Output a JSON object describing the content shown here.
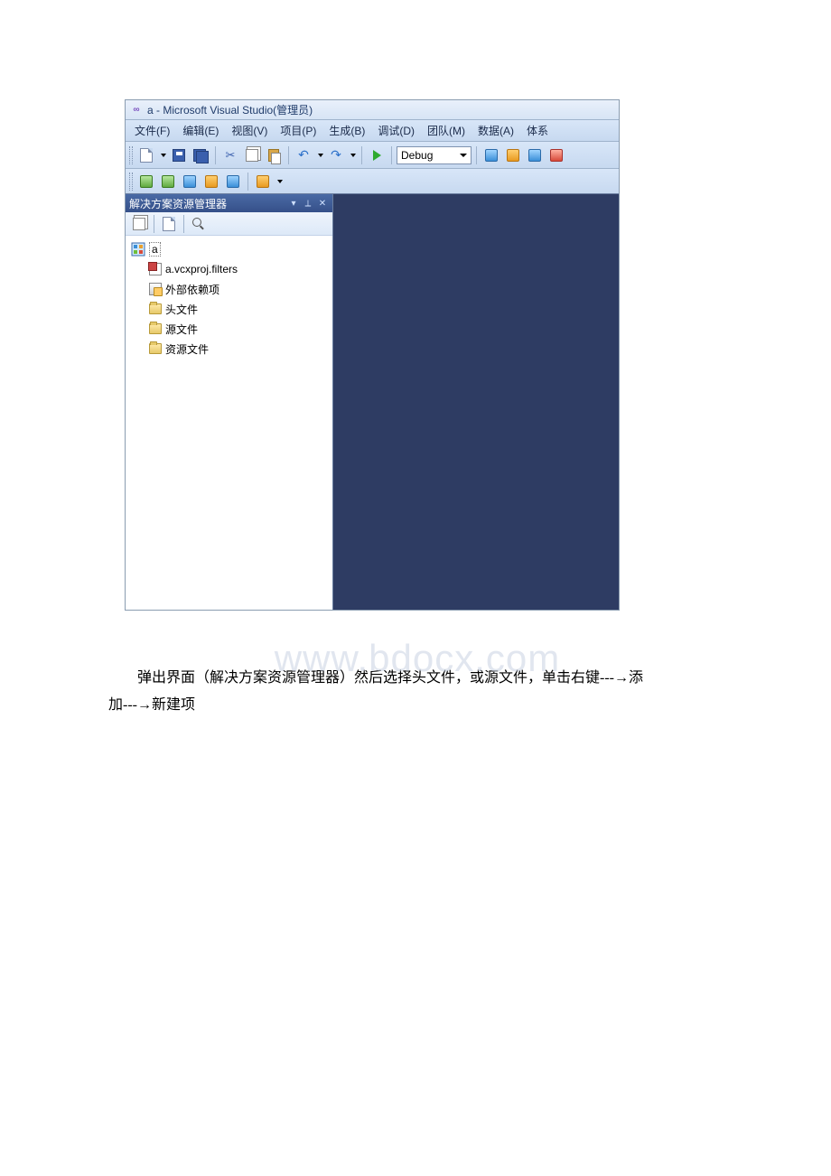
{
  "window": {
    "title": "a - Microsoft Visual Studio(管理员)"
  },
  "menu": {
    "items": [
      "文件(F)",
      "编辑(E)",
      "视图(V)",
      "项目(P)",
      "生成(B)",
      "调试(D)",
      "团队(M)",
      "数据(A)",
      "体系"
    ]
  },
  "toolbar": {
    "config": "Debug"
  },
  "panel": {
    "title": "解决方案资源管理器"
  },
  "tree": {
    "root": "a",
    "items": [
      "a.vcxproj.filters",
      "外部依赖项",
      "头文件",
      "源文件",
      "资源文件"
    ]
  },
  "watermark": "www.bdocx.com",
  "bodytext": {
    "line1": "弹出界面（解决方案资源管理器）然后选择头文件，或源文件，单击右键---→添",
    "line2": "加---→新建项"
  }
}
